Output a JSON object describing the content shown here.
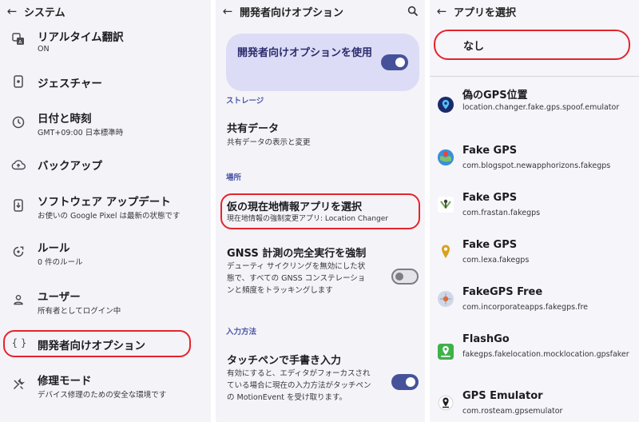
{
  "system_panel": {
    "back_glyph": "←",
    "title": "システム",
    "items": [
      {
        "icon": "translate-icon",
        "title": "リアルタイム翻訳",
        "subtitle": "ON"
      },
      {
        "icon": "phone-gesture-icon",
        "title": "ジェスチャー",
        "subtitle": ""
      },
      {
        "icon": "clock-icon",
        "title": "日付と時刻",
        "subtitle": "GMT+09:00 日本標準時"
      },
      {
        "icon": "cloud-upload-icon",
        "title": "バックアップ",
        "subtitle": ""
      },
      {
        "icon": "system-update-icon",
        "title": "ソフトウェア アップデート",
        "subtitle": "お使いの Google Pixel は最新の状態です"
      },
      {
        "icon": "rules-icon",
        "title": "ルール",
        "subtitle": "0 件のルール"
      },
      {
        "icon": "person-icon",
        "title": "ユーザー",
        "subtitle": "所有者としてログイン中"
      },
      {
        "icon": "developer-braces-icon",
        "icon_text": "{ }",
        "title": "開発者向けオプション",
        "subtitle": ""
      },
      {
        "icon": "repair-tools-icon",
        "title": "修理モード",
        "subtitle": "デバイス修理のための安全な環境です"
      }
    ]
  },
  "developer_panel": {
    "back_glyph": "←",
    "title": "開発者向けオプション",
    "master_toggle": {
      "label": "開発者向けオプションを使用",
      "state": "on"
    },
    "sections": {
      "storage": "ストレージ",
      "location": "場所",
      "input": "入力方法"
    },
    "shared_data": {
      "title": "共有データ",
      "subtitle": "共有データの表示と変更"
    },
    "mock_location": {
      "title": "仮の現在地情報アプリを選択",
      "subtitle": "現在地情報の強制変更アプリ: Location Changer"
    },
    "gnss": {
      "title": "GNSS 計測の完全実行を強制",
      "subtitle": "デューティ サイクリングを無効にした状態で、すべての GNSS コンステレーションと頻度をトラッキングします",
      "state": "off"
    },
    "stylus": {
      "title": "タッチペンで手書き入力",
      "subtitle": "有効にすると、エディタがフォーカスされている場合に現在の入力方法がタッチペンの MotionEvent を受け取ります。",
      "state": "on"
    }
  },
  "app_select_panel": {
    "back_glyph": "←",
    "title": "アプリを選択",
    "none_option": "なし",
    "apps": [
      {
        "icon": "location-changer-icon",
        "name": "偽のGPS位置",
        "package": "location.changer.fake.gps.spoof.emulator",
        "color": "#1b2a6b"
      },
      {
        "icon": "globe-pin-icon",
        "name": "Fake GPS",
        "package": "com.blogspot.newapphorizons.fakegps",
        "color": "#3b8fd8"
      },
      {
        "icon": "joystick-icon",
        "name": "Fake GPS",
        "package": "com.frastan.fakegps",
        "color": "#6aa84f"
      },
      {
        "icon": "map-pin-icon",
        "name": "Fake GPS",
        "package": "com.lexa.fakegps",
        "color": "#d9a21b"
      },
      {
        "icon": "satellite-icon",
        "name": "FakeGPS Free",
        "package": "com.incorporateapps.fakegps.fre",
        "color": "#e06a3a"
      },
      {
        "icon": "flashgo-icon",
        "name": "FlashGo",
        "package": "fakegps.fakelocation.mocklocation.gpsfaker",
        "color": "#3fb24a"
      },
      {
        "icon": "gps-emulator-icon",
        "name": "GPS Emulator",
        "package": "com.rosteam.gpsemulator",
        "color": "#1d1d1d"
      }
    ]
  },
  "colors": {
    "accent": "#45529a",
    "highlight": "#e5242c",
    "section_label": "#4a56a6",
    "card": "#dcdcf6"
  }
}
